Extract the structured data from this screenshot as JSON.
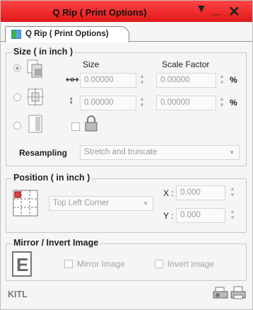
{
  "window": {
    "title": "Q Rip ( Print Options)"
  },
  "tab": {
    "label": "Q Rip ( Print Options)"
  },
  "size_group": {
    "title": "Size ( in inch )",
    "col_size": "Size",
    "col_scale": "Scale Factor",
    "width_value": "0.00000",
    "width_scale": "0.00000",
    "height_value": "0.00000",
    "height_scale": "0.00000",
    "percent": "%",
    "resampling_label": "Resampling",
    "resampling_value": "Stretch and truncate"
  },
  "position_group": {
    "title": "Position ( in inch )",
    "anchor_value": "Top Left Corner",
    "x_label": "X :",
    "x_value": "0.000",
    "y_label": "Y :",
    "y_value": "0.000"
  },
  "mirror_group": {
    "title": "Mirror / Invert Image",
    "mirror_label": "Mirror Image",
    "invert_label": "Invert image"
  },
  "footer": {
    "brand": "KITL"
  }
}
